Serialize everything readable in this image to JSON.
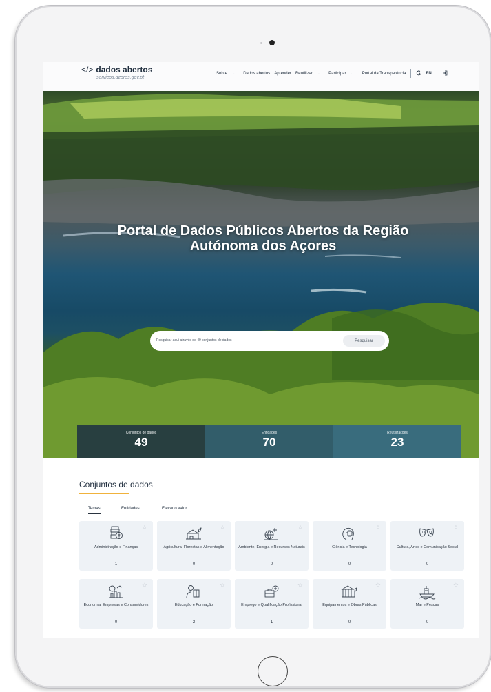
{
  "navbar": {
    "logo_code": "</>",
    "logo_text": "dados abertos",
    "logo_sub": "servicos.azores.gov.pt",
    "menu": {
      "sobre": "Sobre",
      "dados_abertos": "Dados abertos",
      "aprender": "Aprender",
      "reutilizar": "Reutilizar",
      "participar": "Participar",
      "portal": "Portal da Transparência",
      "lang": "EN"
    }
  },
  "hero": {
    "title_line1": "Portal de Dados Públicos Abertos da Região",
    "title_line2": "Autónoma dos Açores",
    "search_placeholder": "Pesquisar aqui através de 49 conjuntos de dados",
    "search_button": "Pesquisar"
  },
  "stats": [
    {
      "label": "Conjuntos de dados",
      "value": "49"
    },
    {
      "label": "Entidades",
      "value": "70"
    },
    {
      "label": "Reutilizações",
      "value": "23"
    }
  ],
  "datasets": {
    "title": "Conjuntos de dados",
    "tabs": [
      "Temas",
      "Entidades",
      "Elevado valor"
    ],
    "active_tab": "Temas",
    "cards": [
      {
        "name": "Administração e Finanças",
        "count": "1",
        "icon": "finance-icon"
      },
      {
        "name": "Agricultura, Florestas e Alimentação",
        "count": "0",
        "icon": "agriculture-icon"
      },
      {
        "name": "Ambiente, Energia e Recursos Naturais",
        "count": "0",
        "icon": "environment-icon"
      },
      {
        "name": "Ciência e Tecnologia",
        "count": "0",
        "icon": "science-icon"
      },
      {
        "name": "Cultura, Artes e Comunicação Social",
        "count": "0",
        "icon": "culture-icon"
      },
      {
        "name": "Economia, Empresas e Consumidores",
        "count": "0",
        "icon": "economy-icon"
      },
      {
        "name": "Educação e Formação",
        "count": "2",
        "icon": "education-icon"
      },
      {
        "name": "Emprego e Qualificação Profissional",
        "count": "1",
        "icon": "employment-icon"
      },
      {
        "name": "Equipamentos e Obras Públicas",
        "count": "0",
        "icon": "public-works-icon"
      },
      {
        "name": "Mar e Pescas",
        "count": "0",
        "icon": "sea-fishing-icon"
      }
    ]
  },
  "colors": {
    "accent": "#f0b23c",
    "navy": "#1f2d3d",
    "card_bg": "#eef2f6"
  }
}
